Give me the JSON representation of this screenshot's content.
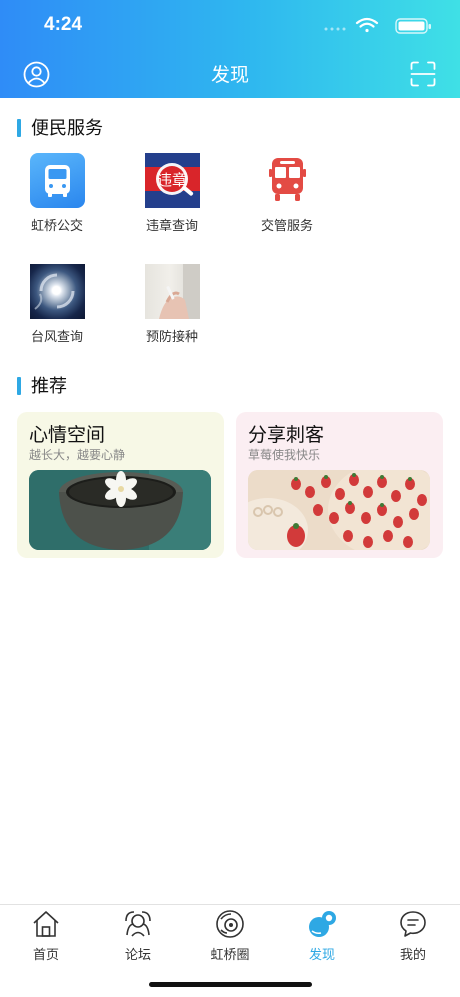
{
  "status": {
    "time": "4:24"
  },
  "header": {
    "title": "发现"
  },
  "services": {
    "title": "便民服务",
    "items": [
      {
        "label": "虹桥公交",
        "icon": "bus-icon"
      },
      {
        "label": "违章查询",
        "icon": "violation-icon",
        "badge": "违章"
      },
      {
        "label": "交管服务",
        "icon": "red-bus-icon"
      },
      {
        "label": "台风查询",
        "icon": "typhoon-image"
      },
      {
        "label": "预防接种",
        "icon": "vaccination-image"
      }
    ]
  },
  "recommend": {
    "title": "推荐",
    "cards": [
      {
        "title": "心情空间",
        "subtitle": "越长大，越要心静",
        "bg": "#f7f8e6"
      },
      {
        "title": "分享刺客",
        "subtitle": "草莓使我快乐",
        "bg": "#fbeef2"
      }
    ]
  },
  "tabs": [
    {
      "label": "首页",
      "icon": "home-icon",
      "active": false
    },
    {
      "label": "论坛",
      "icon": "forum-icon",
      "active": false
    },
    {
      "label": "虹桥圈",
      "icon": "circle-icon",
      "active": false
    },
    {
      "label": "发现",
      "icon": "discover-icon",
      "active": true
    },
    {
      "label": "我的",
      "icon": "chat-icon",
      "active": false
    }
  ],
  "colors": {
    "accent": "#2ea8e4",
    "header_start": "#2f8cf7",
    "header_end": "#3fe0e6"
  }
}
